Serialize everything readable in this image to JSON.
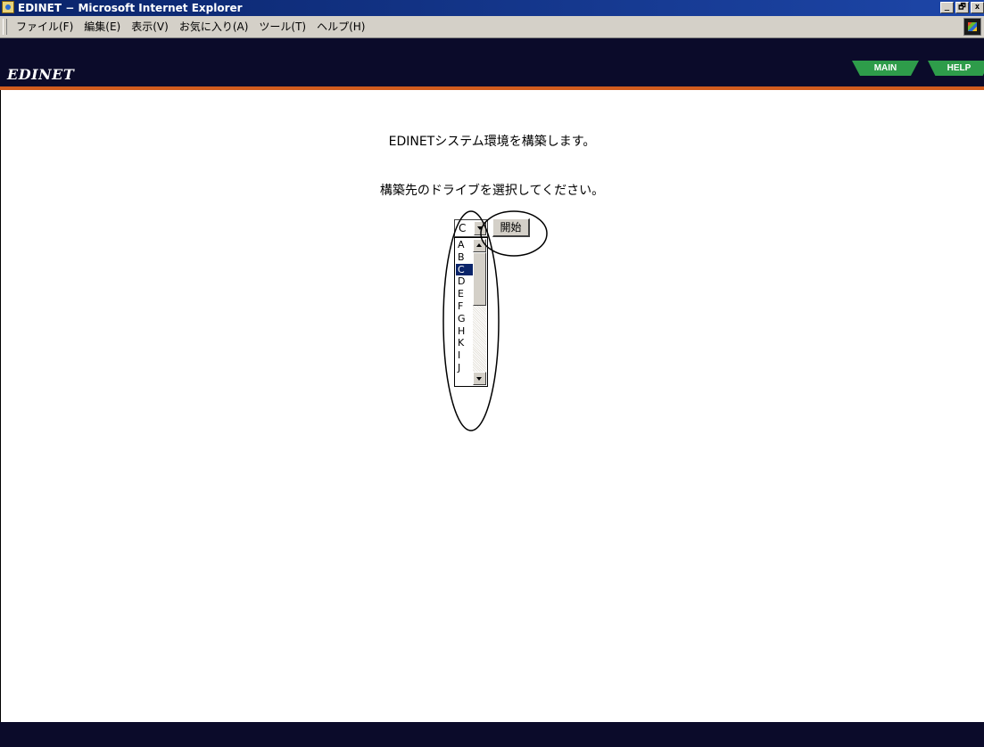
{
  "window": {
    "title": "EDINET − Microsoft Internet Explorer",
    "controls": [
      "_",
      "🗗",
      "x"
    ]
  },
  "menu": {
    "items": [
      "ファイル(F)",
      "編集(E)",
      "表示(V)",
      "お気に入り(A)",
      "ツール(T)",
      "ヘルプ(H)"
    ]
  },
  "header": {
    "brand": "EDINET",
    "tabs": {
      "main": "MAIN",
      "help": "HELP"
    }
  },
  "main": {
    "line1": "EDINETシステム環境を構築します。",
    "line2": "構築先のドライブを選択してください。",
    "drive_select": {
      "value": "C",
      "options": [
        "A",
        "B",
        "C",
        "D",
        "E",
        "F",
        "G",
        "H",
        "K",
        "I",
        "J"
      ],
      "selected": "C"
    },
    "start_button": "開始"
  },
  "colors": {
    "header_bg": "#0b0b2a",
    "header_stripe": "#d25c1e",
    "tab_green": "#2e9c4a",
    "selection": "#0a246a"
  }
}
